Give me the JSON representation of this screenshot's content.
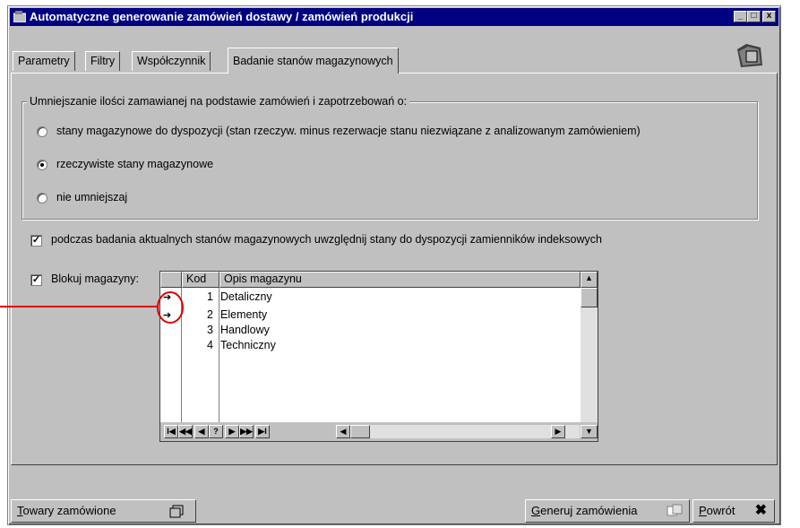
{
  "window": {
    "title": "Automatyczne generowanie zamówień dostawy / zamówień produkcji",
    "min": "_",
    "max": "□",
    "close": "x"
  },
  "tabs": [
    {
      "label": "Parametry",
      "active": false
    },
    {
      "label": "Filtry",
      "active": false
    },
    {
      "label": "Współczynnik",
      "active": false
    },
    {
      "label": "Badanie stanów magazynowych",
      "active": true
    }
  ],
  "group": {
    "label": "Umniejszanie ilości zamawianej na podstawie zamówień i zapotrzebowań o:",
    "options": [
      {
        "label": "stany magazynowe do dyspozycji (stan rzeczyw. minus rezerwacje stanu niezwiązane z analizowanym zamówieniem)",
        "selected": false
      },
      {
        "label": "rzeczywiste stany magazynowe",
        "selected": true
      },
      {
        "label": "nie umniejszaj",
        "selected": false
      }
    ]
  },
  "check_replacements": {
    "label": "podczas badania aktualnych stanów magazynowych uwzględnij stany do dyspozycji zamienników indeksowych",
    "checked": true
  },
  "check_block": {
    "label": "Blokuj magazyny:",
    "checked": true
  },
  "grid": {
    "columns": [
      "",
      "Kod",
      "Opis magazynu"
    ],
    "rows": [
      {
        "marker": "➔",
        "kod": "1",
        "opis": "Detaliczny"
      },
      {
        "marker": "➔",
        "kod": "2",
        "opis": "Elementy"
      },
      {
        "marker": "",
        "kod": "3",
        "opis": "Handlowy"
      },
      {
        "marker": "",
        "kod": "4",
        "opis": "Techniczny"
      }
    ],
    "nav": [
      "I◀",
      "◀◀",
      "◀",
      "?",
      "▶",
      "▶▶",
      "▶I"
    ]
  },
  "buttons": {
    "towary_first": "T",
    "towary_rest": "owary zamówione",
    "generuj_first": "G",
    "generuj_rest": "eneruj zamówienia",
    "powrot_first": "P",
    "powrot_rest": "owrót"
  },
  "colors": {
    "titlebar": "#000080",
    "face": "#c0c0c0",
    "annotation": "#e00000"
  }
}
